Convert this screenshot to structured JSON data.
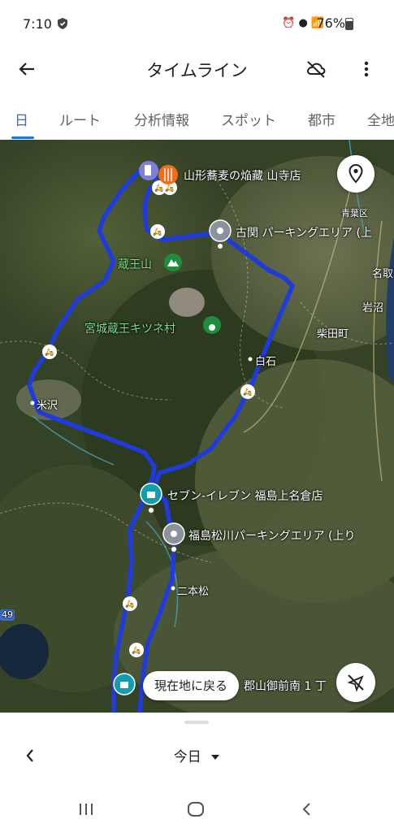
{
  "status_bar": {
    "time": "7:10",
    "battery": "76%"
  },
  "appbar": {
    "title": "タイムライン"
  },
  "tabs": [
    "日",
    "ルート",
    "分析情報",
    "スポット",
    "都市",
    "全地"
  ],
  "map": {
    "places": {
      "yamadera": "山形蕎麦の焔藏 山寺店",
      "kozeki": "古関 パーキングエリア (上",
      "zaosan": "蔵王山",
      "kitsune": "宮城蔵王キツネ村",
      "seven": "セブン-イレブン 福島上名倉店",
      "matsukawa": "福島松川パーキングエリア (上り",
      "koriyama": "郡山御前南 1 丁"
    },
    "towns": {
      "yonezawa": "米沢",
      "shiroishi": "白石",
      "shibata": "柴田町",
      "iwanuma": "岩沼",
      "natori": "名取",
      "aobaku": "青葉区",
      "nihonmatsu": "二本松",
      "route49": "49"
    },
    "return_button": "現在地に戻る"
  },
  "sheet": {
    "date": "今日"
  }
}
